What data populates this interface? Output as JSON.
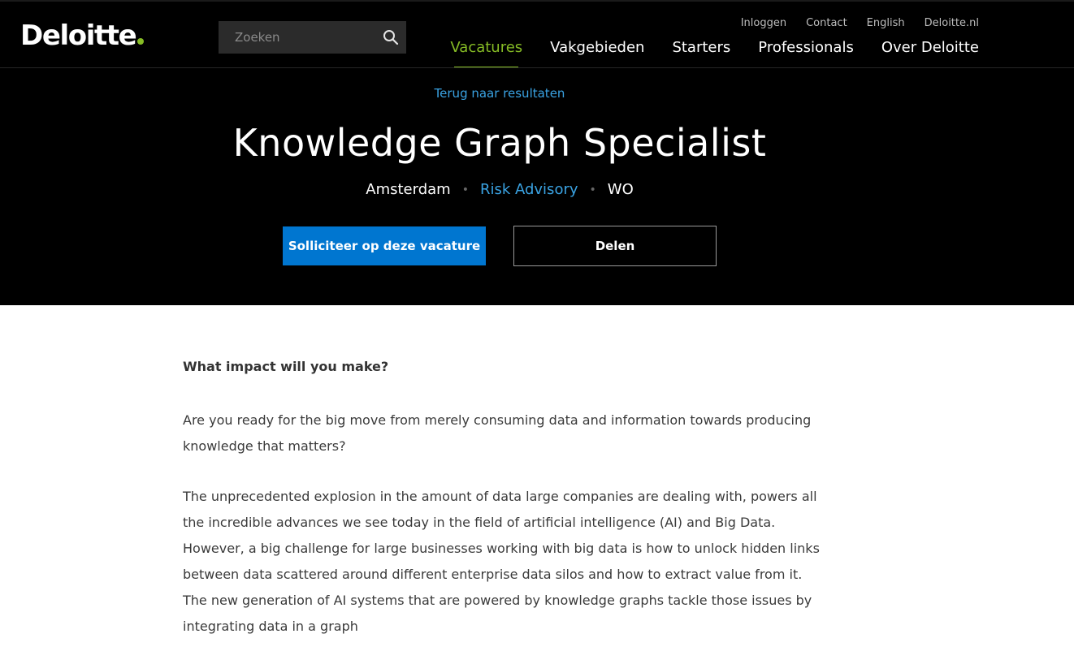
{
  "header": {
    "logo_text": "Deloitte",
    "search_placeholder": "Zoeken",
    "utility_links": [
      "Inloggen",
      "Contact",
      "English",
      "Deloitte.nl"
    ],
    "main_nav": [
      {
        "label": "Vacatures",
        "active": true
      },
      {
        "label": "Vakgebieden",
        "active": false
      },
      {
        "label": "Starters",
        "active": false
      },
      {
        "label": "Professionals",
        "active": false
      },
      {
        "label": "Over Deloitte",
        "active": false
      }
    ]
  },
  "hero": {
    "back_link": "Terug naar resultaten",
    "title": "Knowledge Graph Specialist",
    "location": "Amsterdam",
    "area": "Risk Advisory",
    "level": "WO",
    "separator": "•",
    "apply_label": "Solliciteer op deze vacature",
    "share_label": "Delen"
  },
  "content": {
    "heading": "What impact will you make?",
    "paragraphs": [
      "Are you ready for the big move from merely consuming data and information towards producing knowledge that matters?",
      "The unprecedented explosion in the amount of data large companies are dealing with, powers all the incredible advances we see today in the field of artificial intelligence (AI) and Big Data. However, a big challenge for large businesses working with big data is how to unlock hidden links between data scattered around different enterprise data silos and how to extract value from it. The new generation of AI systems that are powered by knowledge graphs tackle those issues by integrating data in a graph"
    ]
  },
  "colors": {
    "brand_green": "#86bc25",
    "link_blue": "#3aa3e3",
    "button_blue": "#0076d0",
    "hero_background": "#000000"
  },
  "icons": {
    "search": "search-icon",
    "logo_dot": "green-dot"
  }
}
